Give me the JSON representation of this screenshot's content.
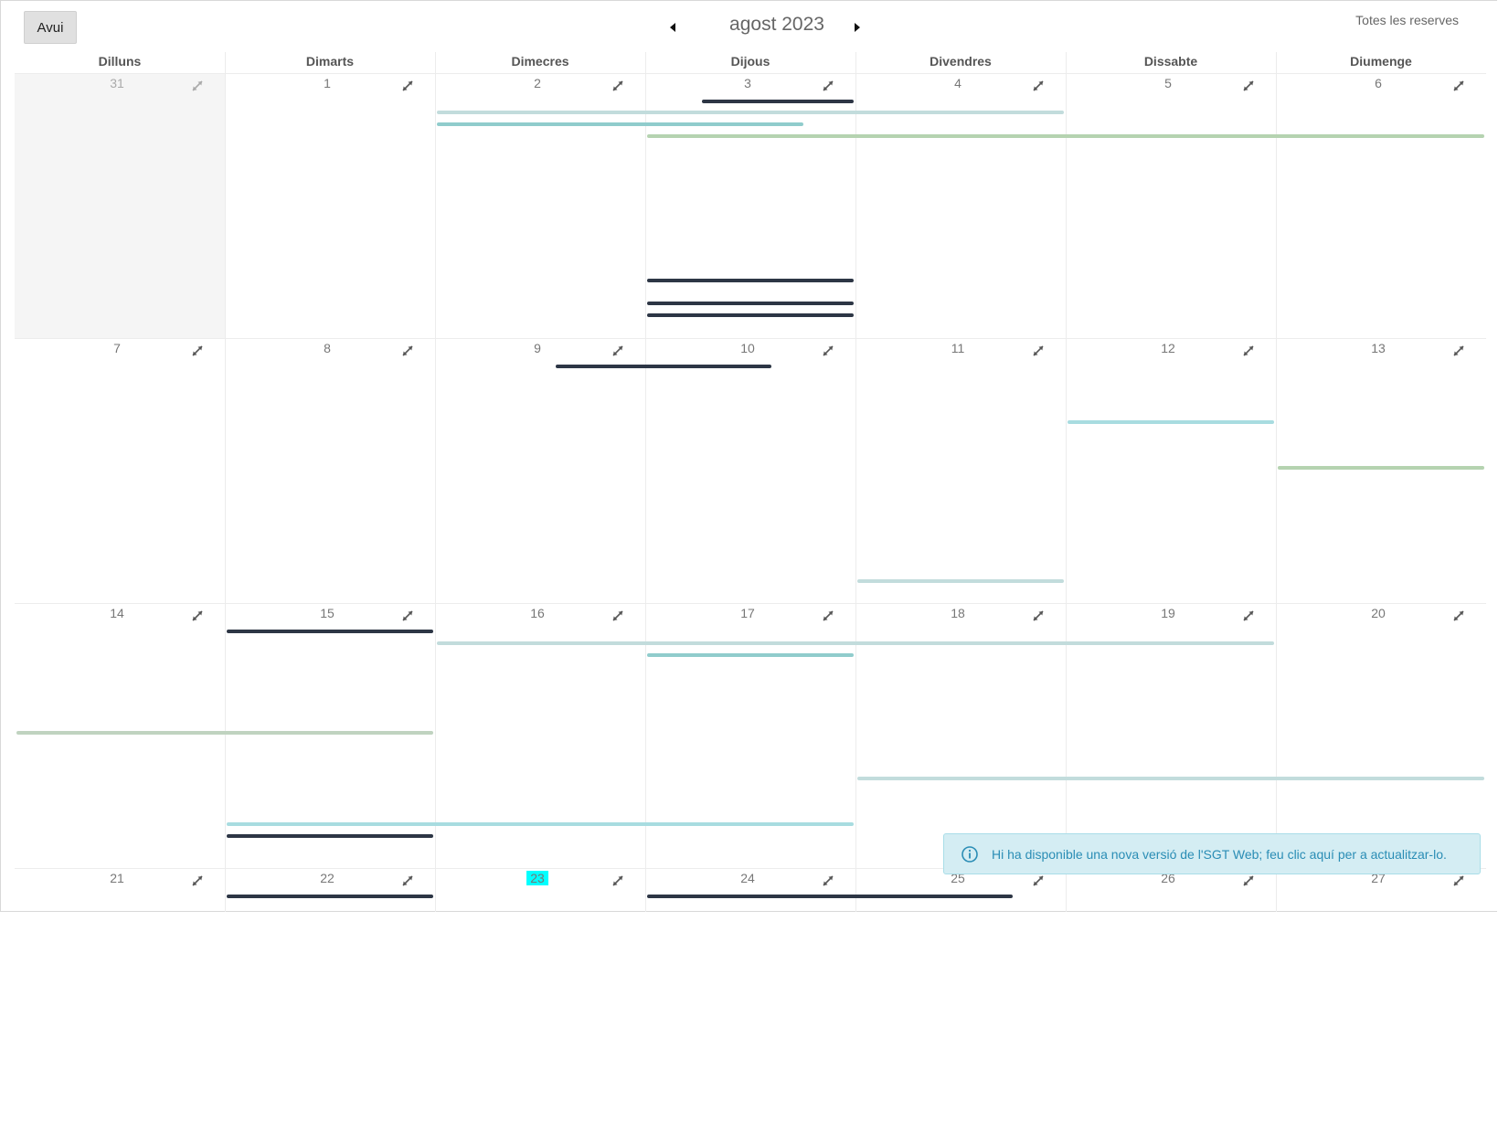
{
  "toolbar": {
    "today_label": "Avui",
    "month_title": "agost 2023",
    "filter_label": "Totes les reserves",
    "prev_icon": "caret-left-icon",
    "next_icon": "caret-right-icon"
  },
  "weekdays": [
    "Dilluns",
    "Dimarts",
    "Dimecres",
    "Dijous",
    "Divendres",
    "Dissabte",
    "Diumenge"
  ],
  "weeks": [
    [
      "31",
      "1",
      "2",
      "3",
      "4",
      "5",
      "6"
    ],
    [
      "7",
      "8",
      "9",
      "10",
      "11",
      "12",
      "13"
    ],
    [
      "14",
      "15",
      "16",
      "17",
      "18",
      "19",
      "20"
    ],
    [
      "21",
      "22",
      "23",
      "24",
      "25",
      "26",
      "27"
    ]
  ],
  "other_month_days": [
    "31"
  ],
  "today": "23",
  "expand_icon": "expand-arrows-icon",
  "event_colors": {
    "navy": "#2d3645",
    "light_teal": "#c2dcdc",
    "teal": "#90cccc",
    "sage": "#b5d3b0",
    "sky": "#a8dce0",
    "grey_green": "#c0d3c0",
    "today_highlight": "#00ffff"
  },
  "events": [
    {
      "week": 0,
      "start_day": "3",
      "end_day": "3",
      "color": "navy"
    },
    {
      "week": 0,
      "start_day": "2",
      "end_day": "4",
      "color": "light_teal"
    },
    {
      "week": 0,
      "start_day": "2",
      "end_day": "3",
      "color": "teal"
    },
    {
      "week": 0,
      "start_day": "3",
      "end_day": "6",
      "color": "sage"
    },
    {
      "week": 0,
      "start_day": "3",
      "end_day": "3",
      "color": "navy"
    },
    {
      "week": 0,
      "start_day": "3",
      "end_day": "3",
      "color": "navy"
    },
    {
      "week": 0,
      "start_day": "3",
      "end_day": "3",
      "color": "navy"
    },
    {
      "week": 1,
      "start_day": "9",
      "end_day": "10",
      "color": "navy"
    },
    {
      "week": 1,
      "start_day": "12",
      "end_day": "12",
      "color": "sky"
    },
    {
      "week": 1,
      "start_day": "13",
      "end_day": "13",
      "color": "sage"
    },
    {
      "week": 1,
      "start_day": "11",
      "end_day": "11",
      "color": "light_teal"
    },
    {
      "week": 2,
      "start_day": "15",
      "end_day": "15",
      "color": "navy"
    },
    {
      "week": 2,
      "start_day": "16",
      "end_day": "19",
      "color": "light_teal"
    },
    {
      "week": 2,
      "start_day": "17",
      "end_day": "17",
      "color": "teal"
    },
    {
      "week": 2,
      "start_day": "14",
      "end_day": "15",
      "color": "grey_green"
    },
    {
      "week": 2,
      "start_day": "18",
      "end_day": "20",
      "color": "light_teal"
    },
    {
      "week": 2,
      "start_day": "15",
      "end_day": "17",
      "color": "sky"
    },
    {
      "week": 2,
      "start_day": "15",
      "end_day": "15",
      "color": "navy"
    },
    {
      "week": 3,
      "start_day": "22",
      "end_day": "22",
      "color": "navy"
    },
    {
      "week": 3,
      "start_day": "24",
      "end_day": "25",
      "color": "navy"
    }
  ],
  "notification": {
    "icon": "info-circle-icon",
    "text": "Hi ha disponible una nova versió de l'SGT Web; feu clic aquí per a actualitzar-lo."
  }
}
